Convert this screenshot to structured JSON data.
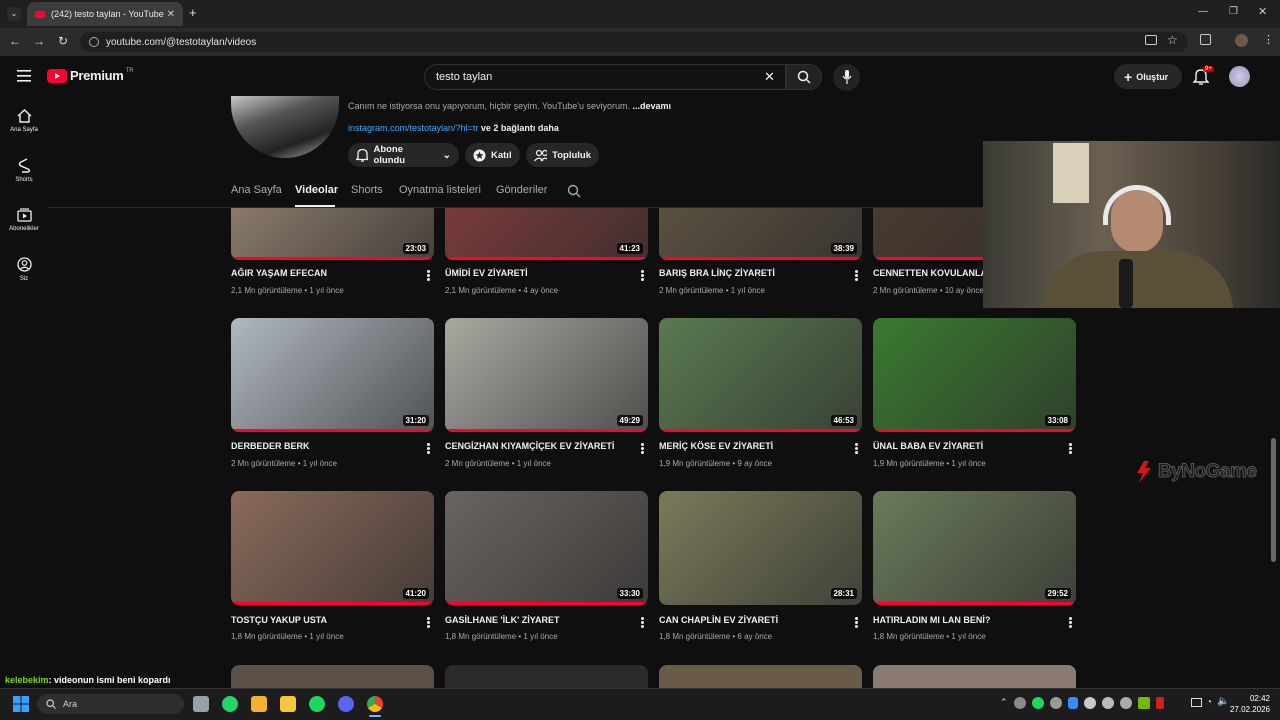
{
  "browser": {
    "tab_title": "(242) testo taylan - YouTube",
    "url": "youtube.com/@testotaylan/videos"
  },
  "header": {
    "logo_text": "Premium",
    "logo_region": "TR",
    "search_value": "testo taylan",
    "create_label": "Oluştur",
    "notif_badge": "9+"
  },
  "sidenav": [
    {
      "label": "Ana Sayfa",
      "icon": "home-icon"
    },
    {
      "label": "Shorts",
      "icon": "shorts-icon"
    },
    {
      "label": "Abonelikler",
      "icon": "subscriptions-icon"
    },
    {
      "label": "Siz",
      "icon": "you-icon"
    }
  ],
  "channel": {
    "description": "Canım ne istiyorsa onu yapıyorum, hiçbir şeyim. YouTube'u seviyorum.",
    "more": "...devamı",
    "link": "instagram.com/testotaylan/?hl=tr",
    "link_more": "ve 2 bağlantı daha",
    "subscribed_label": "Abone olundu",
    "join_label": "Katıl",
    "community_label": "Topluluk",
    "tabs": [
      "Ana Sayfa",
      "Videolar",
      "Shorts",
      "Oynatma listeleri",
      "Gönderiler"
    ]
  },
  "videos": [
    {
      "title": "AĞIR YAŞAM EFECAN",
      "meta": "2,1 Mn görüntüleme • 1 yıl önce",
      "duration": "23:03",
      "progress": 1.0,
      "color": "#8a7a6a"
    },
    {
      "title": "ÜMİDİ EV ZİYARETİ",
      "meta": "2,1 Mn görüntüleme • 4 ay önce",
      "duration": "41:23",
      "progress": 1.0,
      "color": "#7a3a3a"
    },
    {
      "title": "BARIŞ BRA LİNÇ ZİYARETİ",
      "meta": "2 Mn görüntüleme • 1 yıl önce",
      "duration": "38:39",
      "progress": 1.0,
      "color": "#5a5040"
    },
    {
      "title": "CENNETTEN KOVULANLAR",
      "meta": "2 Mn görüntüleme • 10 ay önce",
      "duration": "",
      "progress": 1.0,
      "color": "#4a3a30"
    },
    {
      "title": "DERBEDER BERK",
      "meta": "2 Mn görüntüleme • 1 yıl önce",
      "duration": "31:20",
      "progress": 1.0,
      "color": "#b0b8c0"
    },
    {
      "title": "CENGİZHAN KIYAMÇİÇEK EV ZİYARETİ",
      "meta": "2 Mn görüntüleme • 1 yıl önce",
      "duration": "49:29",
      "progress": 1.0,
      "color": "#a8a8a0"
    },
    {
      "title": "MERİÇ KÖSE EV ZİYARETİ",
      "meta": "1,9 Mn görüntüleme • 9 ay önce",
      "duration": "46:53",
      "progress": 1.0,
      "color": "#5a7a50"
    },
    {
      "title": "ÜNAL BABA EV ZİYARETİ",
      "meta": "1,9 Mn görüntüleme • 1 yıl önce",
      "duration": "33:08",
      "progress": 1.0,
      "color": "#3a7a30"
    },
    {
      "title": "TOSTÇU YAKUP USTA",
      "meta": "1,8 Mn görüntüleme • 1 yıl önce",
      "duration": "41:20",
      "progress": 1.0,
      "color": "#8a6a5a"
    },
    {
      "title": "GASİLHANE 'İLK' ZİYARET",
      "meta": "1,8 Mn görüntüleme • 1 yıl önce",
      "duration": "33:30",
      "progress": 1.0,
      "color": "#6a6460"
    },
    {
      "title": "CAN CHAPLİN EV ZİYARETİ",
      "meta": "1,8 Mn görüntüleme • 6 ay önce",
      "duration": "28:31",
      "progress": 0.0,
      "color": "#7a7a5a"
    },
    {
      "title": "HATIRLADIN MI LAN BENİ?",
      "meta": "1,8 Mn görüntüleme • 1 yıl önce",
      "duration": "29:52",
      "progress": 1.0,
      "color": "#6a7a5a"
    }
  ],
  "overlay": {
    "chat_user": "kelebekim",
    "chat_message": ": videonun ismi beni kopardı",
    "watermark": "ByNoGame"
  },
  "taskbar": {
    "search_placeholder": "Ara",
    "time": "02:42",
    "date": "27.02.2026"
  }
}
